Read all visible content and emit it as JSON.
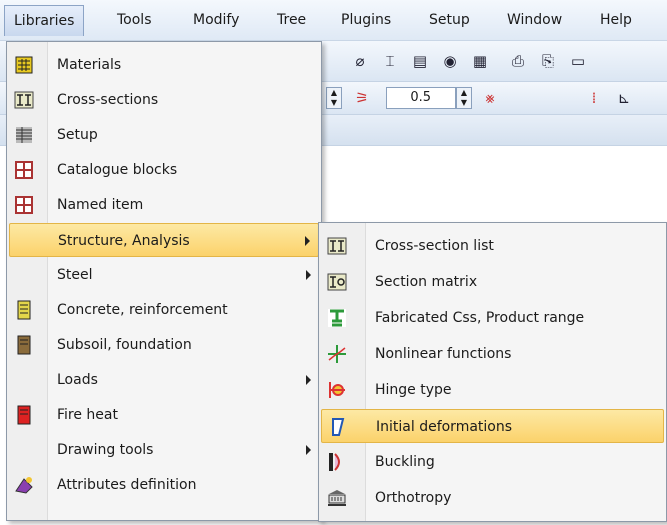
{
  "menubar": {
    "items": [
      "Libraries",
      "Tools",
      "Modify",
      "Tree",
      "Plugins",
      "Setup",
      "Window",
      "Help"
    ]
  },
  "toolbar": {
    "spin_value": "0.5"
  },
  "libraries_menu": {
    "items": [
      {
        "label": "Materials",
        "icon": "materials-icon",
        "submenu": false
      },
      {
        "label": "Cross-sections",
        "icon": "cross-sections-icon",
        "submenu": false
      },
      {
        "label": "Setup",
        "icon": "setup-icon",
        "submenu": false
      },
      {
        "label": "Catalogue blocks",
        "icon": "catalogue-blocks-icon",
        "submenu": false
      },
      {
        "label": "Named item",
        "icon": "named-item-icon",
        "submenu": false
      },
      {
        "label": "Structure, Analysis",
        "icon": "",
        "submenu": true,
        "highlighted": true
      },
      {
        "label": "Steel",
        "icon": "",
        "submenu": true
      },
      {
        "label": "Concrete, reinforcement",
        "icon": "concrete-icon",
        "submenu": false
      },
      {
        "label": "Subsoil, foundation",
        "icon": "subsoil-icon",
        "submenu": false
      },
      {
        "label": "Loads",
        "icon": "",
        "submenu": true
      },
      {
        "label": "Fire heat",
        "icon": "fire-heat-icon",
        "submenu": false
      },
      {
        "label": "Drawing tools",
        "icon": "",
        "submenu": true
      },
      {
        "label": "Attributes definition",
        "icon": "attributes-icon",
        "submenu": false
      }
    ]
  },
  "structure_submenu": {
    "items": [
      {
        "label": "Cross-section list",
        "icon": "cross-section-list-icon"
      },
      {
        "label": "Section matrix",
        "icon": "section-matrix-icon"
      },
      {
        "label": "Fabricated Css, Product range",
        "icon": "fabricated-css-icon"
      },
      {
        "label": "Nonlinear functions",
        "icon": "nonlinear-functions-icon"
      },
      {
        "label": "Hinge type",
        "icon": "hinge-type-icon"
      },
      {
        "label": "Initial deformations",
        "icon": "initial-deformations-icon",
        "highlighted": true
      },
      {
        "label": "Buckling",
        "icon": "buckling-icon"
      },
      {
        "label": "Orthotropy",
        "icon": "orthotropy-icon"
      }
    ]
  },
  "colors": {
    "highlight": "#fbd26b",
    "menu_bg": "#f5f5f5",
    "menubar_bg": "#dfe9f5"
  }
}
